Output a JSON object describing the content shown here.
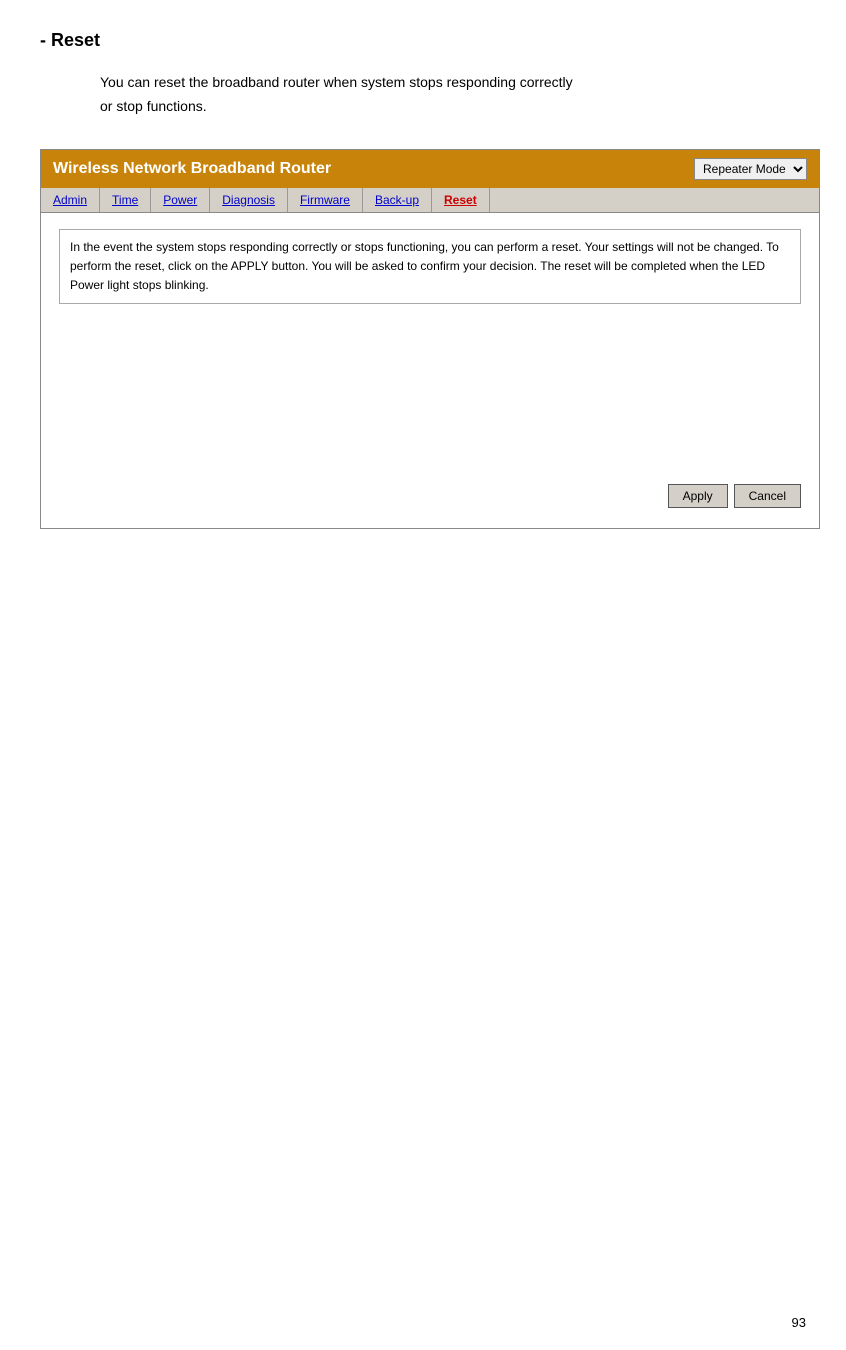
{
  "page": {
    "title": "- Reset",
    "body_line1": "You  can  reset  the  broadband  router  when  system  stops  responding  correctly",
    "body_line2": "or stop functions.",
    "page_number": "93"
  },
  "router_ui": {
    "header": {
      "title": "Wireless Network Broadband Router",
      "mode_label": "Repeater Mode"
    },
    "nav": {
      "items": [
        {
          "label": "Admin",
          "active": false
        },
        {
          "label": "Time",
          "active": false
        },
        {
          "label": "Power",
          "active": false
        },
        {
          "label": "Diagnosis",
          "active": false
        },
        {
          "label": "Firmware",
          "active": false
        },
        {
          "label": "Back-up",
          "active": false
        },
        {
          "label": "Reset",
          "active": true
        }
      ]
    },
    "main": {
      "info_text": "In the event the system stops responding correctly or stops functioning, you can perform a reset. Your settings will not be changed. To perform the reset, click on the APPLY button. You will be asked to confirm your decision. The reset will be completed when the LED Power light stops blinking."
    },
    "buttons": {
      "apply": "Apply",
      "cancel": "Cancel"
    }
  }
}
